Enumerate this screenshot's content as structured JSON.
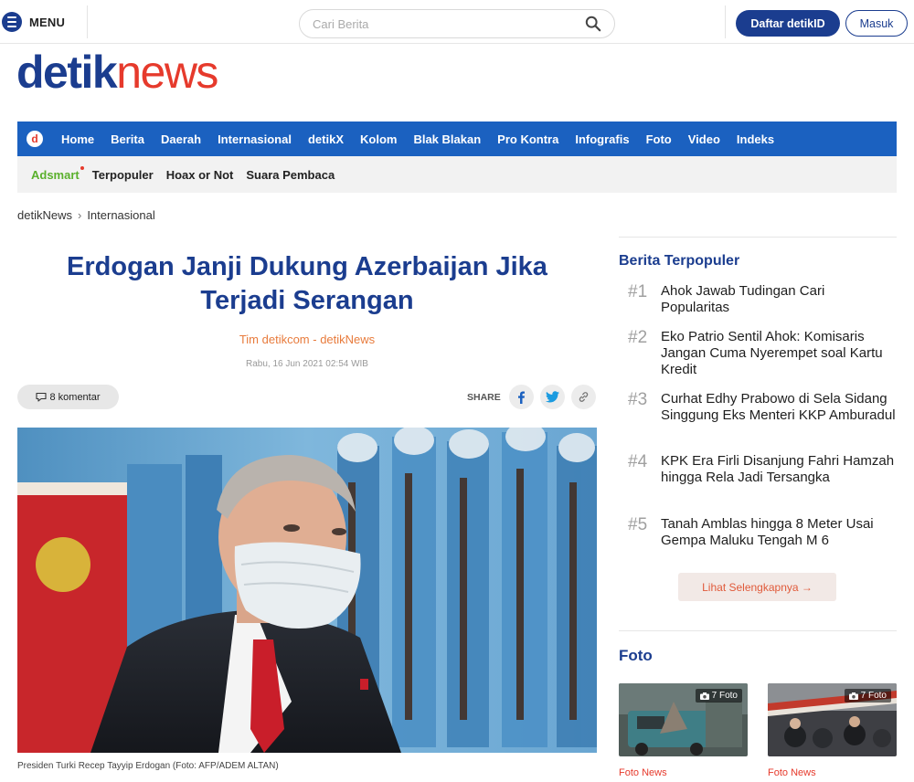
{
  "header": {
    "menu_label": "MENU",
    "search_placeholder": "Cari Berita",
    "register_label": "Daftar detikID",
    "login_label": "Masuk"
  },
  "logo": {
    "part1": "detik",
    "part2": "news"
  },
  "nav": {
    "logo_letter": "d",
    "items": [
      "Home",
      "Berita",
      "Daerah",
      "Internasional",
      "detikX",
      "Kolom",
      "Blak Blakan",
      "Pro Kontra",
      "Infografis",
      "Foto",
      "Video",
      "Indeks"
    ]
  },
  "subnav": {
    "items": [
      "Adsmart",
      "Terpopuler",
      "Hoax or Not",
      "Suara Pembaca"
    ]
  },
  "breadcrumb": {
    "items": [
      "detikNews",
      "Internasional"
    ],
    "separator": "›"
  },
  "article": {
    "title_line1": "Erdogan Janji Dukung Azerbaijan Jika",
    "title_line2": "Terjadi Serangan",
    "author": "Tim detikcom - detikNews",
    "date": "Rabu, 16 Jun 2021 02:54 WIB",
    "comments_label": "8 komentar",
    "share_label": "SHARE",
    "photo_caption": "Presiden Turki Recep Tayyip Erdogan (Foto: AFP/ADEM ALTAN)"
  },
  "sidebar": {
    "popular_heading": "Berita Terpopuler",
    "popular": [
      {
        "rank": "#1",
        "title": "Ahok Jawab Tudingan Cari Popularitas"
      },
      {
        "rank": "#2",
        "title": "Eko Patrio Sentil Ahok: Komisaris Jangan Cuma Nyerempet soal Kartu Kredit"
      },
      {
        "rank": "#3",
        "title": "Curhat Edhy Prabowo di Sela Sidang Singgung Eks Menteri KKP Amburadul"
      },
      {
        "rank": "#4",
        "title": "KPK Era Firli Disanjung Fahri Hamzah hingga Rela Jadi Tersangka"
      },
      {
        "rank": "#5",
        "title": "Tanah Amblas hingga 8 Meter Usai Gempa Maluku Tengah M 6"
      }
    ],
    "more_label": "Lihat Selengkapnya →",
    "foto_heading": "Foto",
    "foto_cards": [
      {
        "badge": "7 Foto",
        "category": "Foto News"
      },
      {
        "badge": "7 Foto",
        "category": "Foto News"
      }
    ]
  },
  "colors": {
    "brand_blue": "#1b3d8f",
    "nav_blue": "#1b61c0",
    "brand_red": "#e63a2c",
    "author_orange": "#e87b3c",
    "adsmart_green": "#5ab02c"
  },
  "icons": {
    "menu": "menu-icon",
    "search": "search-icon",
    "comment": "comment-icon",
    "facebook": "facebook-icon",
    "twitter": "twitter-icon",
    "link": "link-icon",
    "camera": "camera-icon"
  }
}
